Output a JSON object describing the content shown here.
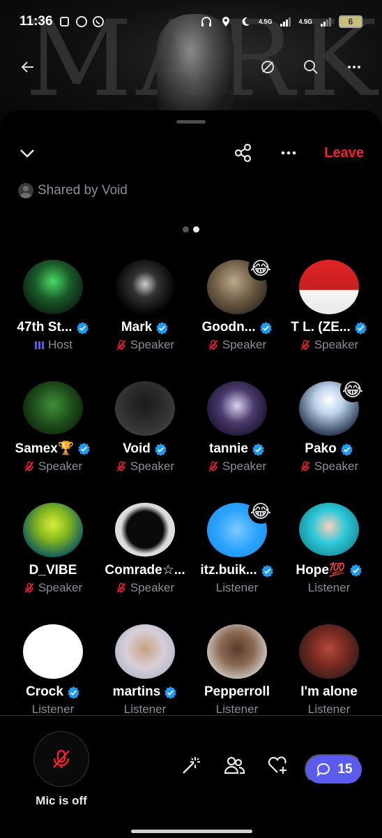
{
  "status_bar": {
    "time": "11:36",
    "net1": "4.5G",
    "net2": "4.5G",
    "battery": "6"
  },
  "background": {
    "word": "MARK"
  },
  "header": {
    "leave_label": "Leave",
    "shared_by": "Shared by Void"
  },
  "colors": {
    "accent_blue": "#1d9bf0",
    "leave_red": "#f4212e",
    "chat_purple": "#5b5bf0",
    "muted_gray": "#8b8f94"
  },
  "participants": [
    {
      "name": "47th St...",
      "verified": true,
      "role": "Host",
      "role_icon": "host-bars-icon",
      "badge": ""
    },
    {
      "name": "Mark",
      "verified": true,
      "role": "Speaker",
      "role_icon": "mic-off-icon",
      "badge": ""
    },
    {
      "name": "Goodn...",
      "verified": true,
      "role": "Speaker",
      "role_icon": "mic-off-icon",
      "badge": "😂"
    },
    {
      "name": "T L. (ZE...",
      "verified": true,
      "role": "Speaker",
      "role_icon": "mic-off-icon",
      "badge": ""
    },
    {
      "name": "Samex🏆",
      "verified": true,
      "role": "Speaker",
      "role_icon": "mic-off-icon",
      "badge": ""
    },
    {
      "name": "Void",
      "verified": true,
      "role": "Speaker",
      "role_icon": "mic-off-icon",
      "badge": ""
    },
    {
      "name": "tannie",
      "verified": true,
      "role": "Speaker",
      "role_icon": "mic-off-icon",
      "badge": ""
    },
    {
      "name": "Pako",
      "verified": true,
      "role": "Speaker",
      "role_icon": "mic-off-icon",
      "badge": "😂"
    },
    {
      "name": "D_VIBE",
      "verified": false,
      "role": "Speaker",
      "role_icon": "mic-off-icon",
      "badge": ""
    },
    {
      "name": "Comrade☆...",
      "verified": false,
      "role": "Speaker",
      "role_icon": "mic-off-icon",
      "badge": ""
    },
    {
      "name": "itz.buik...",
      "verified": true,
      "role": "Listener",
      "role_icon": "",
      "badge": "😂"
    },
    {
      "name": "Hope💯",
      "verified": true,
      "role": "Listener",
      "role_icon": "",
      "badge": ""
    },
    {
      "name": "Crock",
      "verified": true,
      "role": "Listener",
      "role_icon": "",
      "badge": ""
    },
    {
      "name": "martins",
      "verified": true,
      "role": "Listener",
      "role_icon": "",
      "badge": ""
    },
    {
      "name": "Pepperroll",
      "verified": false,
      "role": "Listener",
      "role_icon": "",
      "badge": ""
    },
    {
      "name": "I'm alone",
      "verified": false,
      "role": "Listener",
      "role_icon": "",
      "badge": ""
    }
  ],
  "bottom_bar": {
    "mic_label": "Mic is off",
    "chat_count": "15"
  }
}
